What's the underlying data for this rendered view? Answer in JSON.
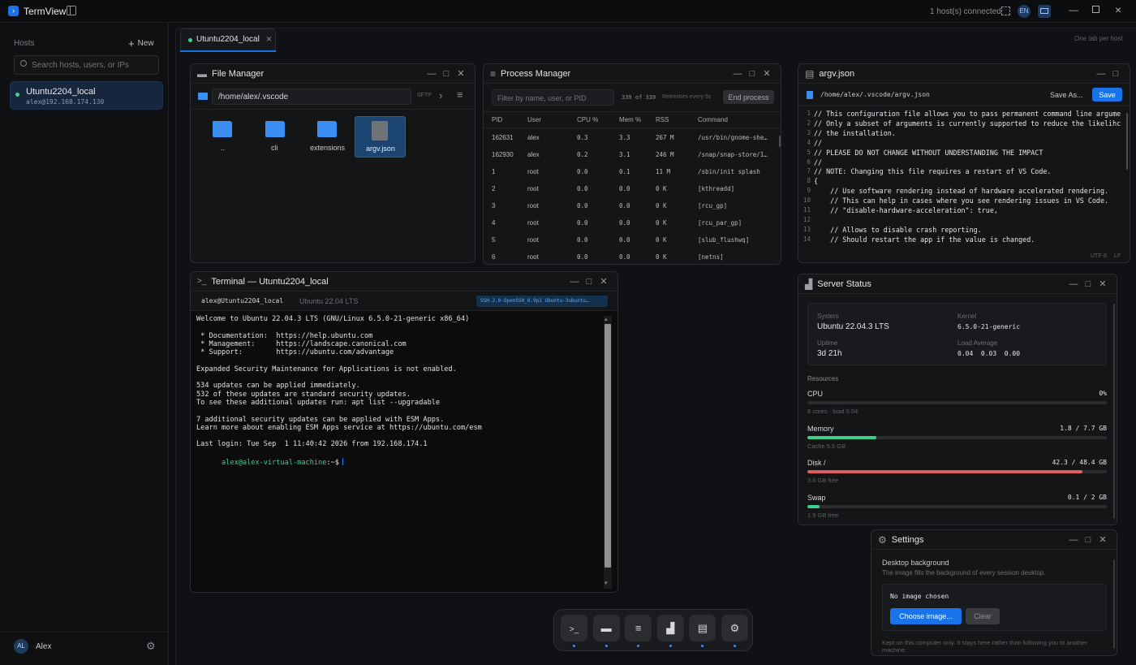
{
  "app": {
    "title": "TermView",
    "connected": "1 host(s) connected",
    "lang": "EN",
    "accent": "#1a73e8"
  },
  "sidebar": {
    "hosts_label": "Hosts",
    "new_label": "New",
    "search_placeholder": "Search hosts, users, or IPs",
    "hosts": [
      {
        "name": "Utuntu2204_local",
        "address": "alex@192.168.174.130",
        "status_color": "#3ecf8e"
      }
    ],
    "user": {
      "initials": "AL",
      "name": "Alex"
    }
  },
  "tabs": {
    "items": [
      {
        "label": "Utuntu2204_local"
      }
    ],
    "hint": "One tab per host"
  },
  "file_manager": {
    "title": "File Manager",
    "path": "/home/alex/.vscode",
    "protocol": "SFTP",
    "files": [
      {
        "name": "..",
        "kind": "folder"
      },
      {
        "name": "cli",
        "kind": "folder"
      },
      {
        "name": "extensions",
        "kind": "folder"
      },
      {
        "name": "argv.json",
        "kind": "file",
        "selected": true
      }
    ]
  },
  "process_manager": {
    "title": "Process Manager",
    "filter_placeholder": "Filter by name, user, or PID",
    "count": "339 of 339",
    "refresh": "Refreshes every 5s",
    "end_label": "End process",
    "columns": [
      "PID",
      "User",
      "CPU %",
      "Mem %",
      "RSS",
      "Command"
    ],
    "rows": [
      [
        "162631",
        "alex",
        "0.3",
        "3.3",
        "267 M",
        "/usr/bin/gnome-she…"
      ],
      [
        "162930",
        "alex",
        "0.2",
        "3.1",
        "246 M",
        "/snap/snap-store/1…"
      ],
      [
        "1",
        "root",
        "0.0",
        "0.1",
        "11 M",
        "/sbin/init splash"
      ],
      [
        "2",
        "root",
        "0.0",
        "0.0",
        "0 K",
        "[kthreadd]"
      ],
      [
        "3",
        "root",
        "0.0",
        "0.0",
        "0 K",
        "[rcu_gp]"
      ],
      [
        "4",
        "root",
        "0.0",
        "0.0",
        "0 K",
        "[rcu_par_gp]"
      ],
      [
        "5",
        "root",
        "0.0",
        "0.0",
        "0 K",
        "[slub_flushwq]"
      ],
      [
        "6",
        "root",
        "0.0",
        "0.0",
        "0 K",
        "[netns]"
      ]
    ]
  },
  "editor": {
    "title": "argv.json",
    "path": "/home/alex/.vscode/argv.json",
    "save_as": "Save As...",
    "save": "Save",
    "encoding": "UTF-8",
    "eol": "LF",
    "lines": [
      "// This configuration file allows you to pass permanent command line argume",
      "// Only a subset of arguments is currently supported to reduce the likelihc",
      "// the installation.",
      "//",
      "// PLEASE DO NOT CHANGE WITHOUT UNDERSTANDING THE IMPACT",
      "//",
      "// NOTE: Changing this file requires a restart of VS Code.",
      "{",
      "    // Use software rendering instead of hardware accelerated rendering.",
      "    // This can help in cases where you see rendering issues in VS Code.",
      "    // \"disable-hardware-acceleration\": true,",
      "",
      "    // Allows to disable crash reporting.",
      "    // Should restart the app if the value is changed."
    ]
  },
  "terminal": {
    "title": "Terminal — Utuntu2204_local",
    "session": "alex@Utuntu2204_local",
    "os": "Ubuntu 22.04 LTS",
    "ssh": "SSH-2.0-OpenSSH_8.9p1 Ubuntu-3ubuntu…",
    "lines": [
      "Welcome to Ubuntu 22.04.3 LTS (GNU/Linux 6.5.0-21-generic x86_64)",
      "",
      " * Documentation:  https://help.ubuntu.com",
      " * Management:     https://landscape.canonical.com",
      " * Support:        https://ubuntu.com/advantage",
      "",
      "Expanded Security Maintenance for Applications is not enabled.",
      "",
      "534 updates can be applied immediately.",
      "532 of these updates are standard security updates.",
      "To see these additional updates run: apt list --upgradable",
      "",
      "7 additional security updates can be applied with ESM Apps.",
      "Learn more about enabling ESM Apps service at https://ubuntu.com/esm",
      "",
      "Last login: Tue Sep  1 11:40:42 2026 from 192.168.174.1"
    ],
    "prompt_user": "alex@alex-virtual-machine",
    "prompt_tail": ":~$"
  },
  "server_status": {
    "title": "Server Status",
    "system_label": "System",
    "system": "Ubuntu 22.04.3 LTS",
    "kernel_label": "Kernel",
    "kernel": "6.5.0-21-generic",
    "uptime_label": "Uptime",
    "uptime": "3d 21h",
    "load_label": "Load Average",
    "load": "0.04  0.03  0.00",
    "resources_label": "Resources",
    "resources": [
      {
        "name": "CPU",
        "value": "0%",
        "sub": "8 cores · load 0.04",
        "fraction": 0.0,
        "color": "#3ecf8e"
      },
      {
        "name": "Memory",
        "value": "1.8 / 7.7 GB",
        "sub": "Cache 5.5 GB",
        "fraction": 0.23,
        "color": "#3ecf8e"
      },
      {
        "name": "Disk /",
        "value": "42.3 / 48.4 GB",
        "sub": "3.6 GB free",
        "fraction": 0.92,
        "color": "#e05d5d"
      },
      {
        "name": "Swap",
        "value": "0.1 / 2 GB",
        "sub": "1.9 GB free",
        "fraction": 0.04,
        "color": "#3ecf8e"
      }
    ]
  },
  "settings": {
    "title": "Settings",
    "section": "Desktop background",
    "desc": "The image fills the background of every session desktop.",
    "no_image": "No image chosen",
    "choose": "Choose image...",
    "clear": "Clear",
    "note": "Kept on this computer only. It stays here rather than following you to another machine."
  },
  "dock": {
    "items": [
      "terminal-icon",
      "folder-icon",
      "list-icon",
      "chart-icon",
      "document-icon",
      "gear-icon"
    ]
  }
}
